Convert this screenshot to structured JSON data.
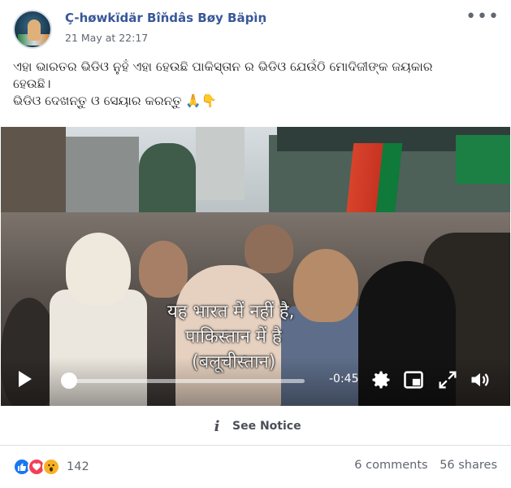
{
  "post": {
    "author": "Ç-høwkïdär Bîňdâs Bøy Bäpìņ",
    "timestamp": "21 May at 22:17",
    "more_icon": "ellipsis-icon",
    "text_lines": [
      "ଏହା ଭାରତର ଭିଡିଓ ନୁହଁ ଏହା ହେଉଛି ପାକିସ୍ତାନ ର ଭିଡିଓ ଯେଉଁଠି ମୋଦିଜୀଙ୍କ ଜୟକାର",
      "ହେଉଛି।",
      "ଭିଡିଓ ଦେଖନ୍ତୁ ଓ ସେୟାର କରନ୍ତୁ 🙏👇"
    ]
  },
  "video": {
    "caption_lines": [
      "यह भारत में नहीं है,",
      "पाकिस्तान में है",
      "(बलूचीस्तान)"
    ],
    "time_remaining": "-0:45",
    "progress_fraction": 0.0,
    "controls": [
      "play-icon",
      "settings-icon",
      "picture-in-picture-icon",
      "fullscreen-icon",
      "volume-icon"
    ]
  },
  "notice": {
    "icon": "info-icon",
    "label": "See Notice"
  },
  "footer": {
    "reaction_icons": [
      "like-icon",
      "love-icon",
      "wow-icon"
    ],
    "reaction_count": "142",
    "comments": "6 comments",
    "shares": "56 shares"
  },
  "colors": {
    "author_link": "#385898",
    "secondary_text": "#616770",
    "like": "#1877f2",
    "love": "#f33e58",
    "wow": "#f7b125"
  }
}
